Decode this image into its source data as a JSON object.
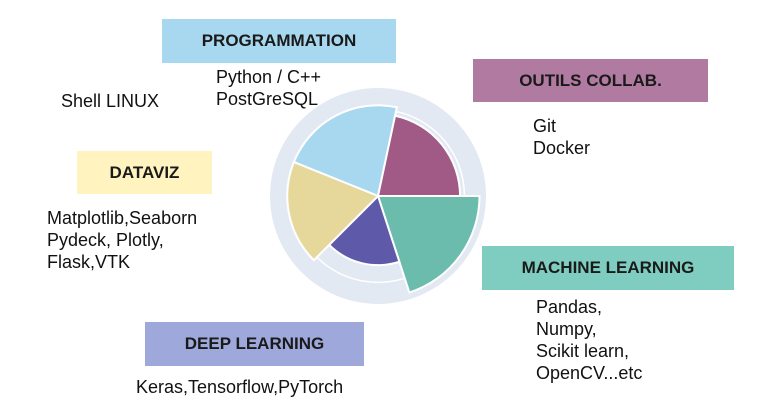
{
  "colors": {
    "programmation": "#a8d8ef",
    "outils": "#b07aa1",
    "machine_learning": "#7ecdc0",
    "deep_learning": "#9fa8da",
    "dataviz": "#fff4c0",
    "ring_bg": "#e3e9f3"
  },
  "labels": {
    "programmation": "PROGRAMMATION",
    "outils": "OUTILS COLLAB.",
    "dataviz": "DATAVIZ",
    "machine_learning": "MACHINE LEARNING",
    "deep_learning": "DEEP LEARNING"
  },
  "details": {
    "programmation": [
      "Python / C++",
      "PostGreSQL"
    ],
    "shell": "Shell LINUX",
    "outils": [
      "Git",
      "Docker"
    ],
    "dataviz": [
      "Matplotlib,Seaborn",
      "Pydeck, Plotly,",
      "Flask,VTK"
    ],
    "machine_learning": [
      "Pandas,",
      "Numpy,",
      "Scikit learn,",
      "OpenCV...etc"
    ],
    "deep_learning": "Keras,Tensorflow,PyTorch"
  },
  "chart_data": {
    "type": "polar_area",
    "rmax": 5,
    "grid": true,
    "series": [
      {
        "key": "programmation",
        "start_deg": -68,
        "end_deg": 12,
        "value": 4.2,
        "color": "#a8d8ef"
      },
      {
        "key": "outils",
        "start_deg": 12,
        "end_deg": 90,
        "value": 3.8,
        "color": "#a05a85"
      },
      {
        "key": "machine_learning",
        "start_deg": 90,
        "end_deg": 162,
        "value": 4.7,
        "color": "#6cbcae"
      },
      {
        "key": "deep_learning",
        "start_deg": 162,
        "end_deg": 225,
        "value": 3.2,
        "color": "#5e59a8"
      },
      {
        "key": "dataviz",
        "start_deg": 225,
        "end_deg": 292,
        "value": 4.2,
        "color": "#e6d79a"
      }
    ]
  }
}
